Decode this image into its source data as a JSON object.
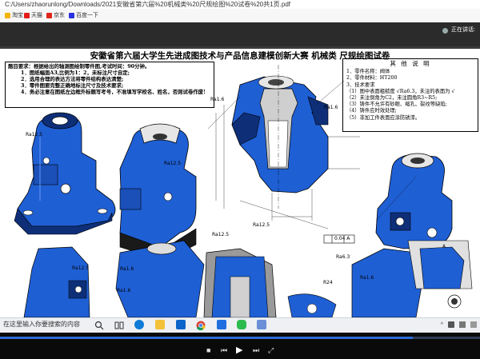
{
  "browser": {
    "url": "C:/Users/zhaorunlong/Downloads/2021安徽省第六届%20机械类%20尺规绘图%20试卷%20共1页.pdf",
    "bookmarks": [
      {
        "label": "淘宝",
        "icon": "folder-icon",
        "color": "#f4b400"
      },
      {
        "label": "天猫",
        "icon": "tmall-icon",
        "color": "#e31d1a"
      },
      {
        "label": "京东",
        "icon": "jd-icon",
        "color": "#e1251b"
      },
      {
        "label": "百度一下",
        "icon": "baidu-icon",
        "color": "#2932e1"
      }
    ]
  },
  "meeting": {
    "label": "正在讲话:"
  },
  "drawing": {
    "title": "安徽省第六届大学生先进成图技术与产品信息建模创新大赛  机械类  尺规绘图试卷",
    "requirements": {
      "heading": "题目要求：根据给出的轴测图绘制零件图,考试时间：90分钟。",
      "items": [
        "1．图纸幅面A3,比例为1：2，未标注尺寸自定;",
        "2．选用合理的表达方法将零件结构表达清楚;",
        "3．零件图要完整正确地标注尺寸及技术要求;",
        "4．务必注意在图纸左边框外标题写考号，不准填写学校名、姓名，否则试卷作废!"
      ]
    },
    "notes": {
      "title": "其 他 说 明",
      "lines": [
        "1．零件名称：阀体",
        "2．零件材料：HT200",
        "3．技术要求",
        "（1）图中表面粗糙度 √Ra6.3，未注的表面为 √",
        "（2）未注倒角为C2，未注圆角R3~R5;",
        "（3）铸件不允许有砂眼、缩孔、裂纹等缺陷;",
        "（4）铸件应时效处理;",
        "（5）非加工件表面应涂防锈漆。"
      ]
    },
    "dimensions": [
      "Ra12.5",
      "Ra1.6",
      "Ra1.6",
      "Ra12.5",
      "Ra12.5",
      "Ra12.5",
      "Ra1.6",
      "0.04 A",
      "Ra6.3",
      "Ra1.6",
      "A",
      "R24",
      "Ra12.5",
      "Ra1.6"
    ],
    "colors": {
      "part_blue": "#1f5fd4",
      "part_dark": "#0e2f78",
      "part_grey": "#9a9a9a"
    }
  },
  "taskbar": {
    "search_text": "在这里输入你要搜索的内容",
    "apps": [
      "search-icon",
      "task-view-icon",
      "edge-icon",
      "file-explorer-icon",
      "store-icon",
      "chrome-icon",
      "meeting-app-icon",
      "wechat-icon",
      "image-viewer-icon"
    ]
  },
  "player": {
    "progress": 0.86
  }
}
